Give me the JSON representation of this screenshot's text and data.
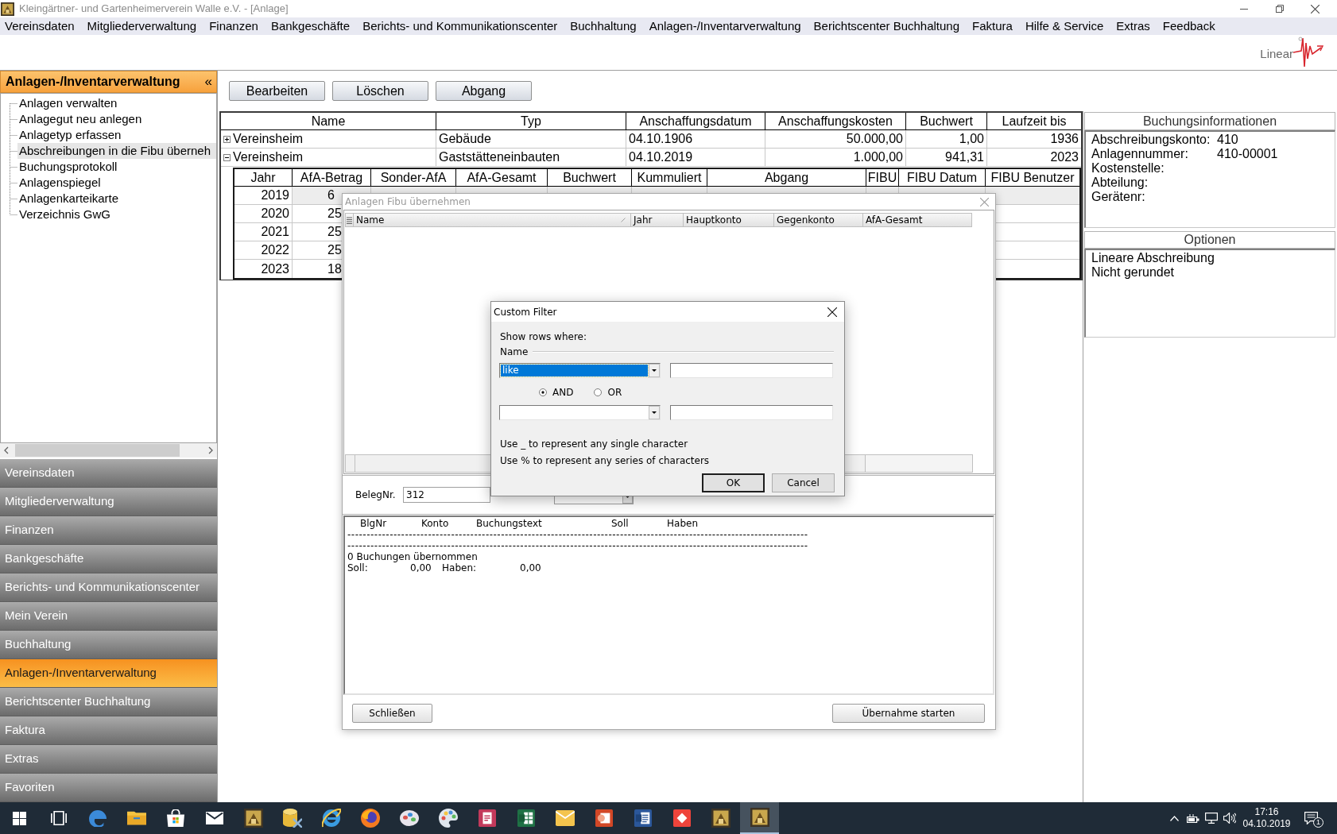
{
  "window": {
    "title": "Kleingärtner- und Gartenheimerverein Walle e.V. - [Anlage]"
  },
  "menu": [
    "Vereinsdaten",
    "Mitgliederverwaltung",
    "Finanzen",
    "Bankgeschäfte",
    "Berichts- und Kommunikationscenter",
    "Buchhaltung",
    "Anlagen-/Inventarverwaltung",
    "Berichtscenter Buchhaltung",
    "Faktura",
    "Hilfe & Service",
    "Extras",
    "Feedback"
  ],
  "logo": {
    "text": "Linear"
  },
  "sidebar": {
    "title": "Anlagen-/Inventarverwaltung",
    "collapse": "«",
    "tree": [
      {
        "label": "Anlagen verwalten",
        "selected": false
      },
      {
        "label": "Anlagegut neu anlegen",
        "selected": false
      },
      {
        "label": "Anlagetyp erfassen",
        "selected": false
      },
      {
        "label": "Abschreibungen in die Fibu überneh",
        "selected": true
      },
      {
        "label": "Buchungsprotokoll",
        "selected": false
      },
      {
        "label": "Anlagenspiegel",
        "selected": false
      },
      {
        "label": "Anlagenkarteikarte",
        "selected": false
      },
      {
        "label": "Verzeichnis GwG",
        "selected": false
      }
    ],
    "nav": [
      {
        "label": "Vereinsdaten",
        "selected": false
      },
      {
        "label": "Mitgliederverwaltung",
        "selected": false
      },
      {
        "label": "Finanzen",
        "selected": false
      },
      {
        "label": "Bankgeschäfte",
        "selected": false
      },
      {
        "label": "Berichts- und Kommunikationscenter",
        "selected": false
      },
      {
        "label": "Mein Verein",
        "selected": false
      },
      {
        "label": "Buchhaltung",
        "selected": false
      },
      {
        "label": "Anlagen-/Inventarverwaltung",
        "selected": true
      },
      {
        "label": "Berichtscenter Buchhaltung",
        "selected": false
      },
      {
        "label": "Faktura",
        "selected": false
      },
      {
        "label": "Extras",
        "selected": false
      },
      {
        "label": "Favoriten",
        "selected": false
      }
    ]
  },
  "toolbar": [
    "Bearbeiten",
    "Löschen",
    "Abgang"
  ],
  "table": {
    "columns": [
      "Name",
      "Typ",
      "Anschaffungsdatum",
      "Anschaffungskosten",
      "Buchwert",
      "Laufzeit bis"
    ],
    "rows": [
      {
        "expanded": false,
        "cells": [
          "Vereinsheim",
          "Gebäude",
          "04.10.1906",
          "50.000,00",
          "1,00",
          "1936"
        ]
      },
      {
        "expanded": true,
        "cells": [
          "Vereinsheim",
          "Gaststätteneinbauten",
          "04.10.2019",
          "1.000,00",
          "941,31",
          "2023"
        ],
        "detail": {
          "columns": [
            "Jahr",
            "AfA-Betrag",
            "Sonder-AfA",
            "AfA-Gesamt",
            "Buchwert",
            "Kummuliert",
            "Abgang",
            "FIBU",
            "FIBU Datum",
            "FIBU Benutzer"
          ],
          "rows": [
            {
              "selected": true,
              "cells": [
                "2019",
                "6"
              ]
            },
            {
              "selected": false,
              "cells": [
                "2020",
                "25"
              ]
            },
            {
              "selected": false,
              "cells": [
                "2021",
                "25"
              ]
            },
            {
              "selected": false,
              "cells": [
                "2022",
                "25"
              ]
            },
            {
              "selected": false,
              "cells": [
                "2023",
                "18"
              ]
            }
          ]
        }
      }
    ]
  },
  "booking_info": {
    "title": "Buchungsinformationen",
    "fields": [
      {
        "label": "Abschreibungskonto:",
        "value": "410"
      },
      {
        "label": "Anlagennummer:",
        "value": "410-00001"
      },
      {
        "label": "Kostenstelle:"
      },
      {
        "label": "Abteilung:"
      },
      {
        "label": "Gerätenr:"
      }
    ]
  },
  "options": {
    "title": "Optionen",
    "lines": [
      "Lineare Abschreibung",
      "Nicht gerundet"
    ]
  },
  "fibu_dialog": {
    "title": "Anlagen Fibu übernehmen",
    "grid_columns": [
      "Name",
      "Jahr",
      "Hauptkonto",
      "Gegenkonto",
      "AfA-Gesamt"
    ],
    "beleg_label": "BelegNr.",
    "beleg_value": "312",
    "log": {
      "columns": [
        "BlgNr",
        "Konto",
        "Buchungstext",
        "Soll",
        "Haben"
      ],
      "rules": [
        "------------------------------------------------------------------------------------------------------------------------",
        "------------------------------------------------------------------------------------------------------------------------"
      ],
      "summary": "0 Buchungen übernommen",
      "totals": [
        {
          "label": "Soll:",
          "value": "0,00"
        },
        {
          "label": "Haben:",
          "value": "0,00"
        }
      ]
    },
    "buttons": [
      "Schließen",
      "Übernahme starten"
    ]
  },
  "filter_dialog": {
    "title": "Custom Filter",
    "prompt": "Show rows where:",
    "field": "Name",
    "operator": "like",
    "operator_focused": true,
    "logic": [
      {
        "label": "AND",
        "selected": true
      },
      {
        "label": "OR",
        "selected": false
      }
    ],
    "hints": [
      "Use _ to represent any single character",
      "Use % to represent any series of characters"
    ],
    "buttons": [
      {
        "label": "OK",
        "default": true
      },
      {
        "label": "Cancel",
        "default": false
      }
    ]
  },
  "taskbar": {
    "apps": [
      {
        "kind": "start",
        "selected": false
      },
      {
        "kind": "taskview",
        "selected": false
      },
      {
        "kind": "edge",
        "selected": false
      },
      {
        "kind": "folder",
        "selected": false
      },
      {
        "kind": "store",
        "selected": false
      },
      {
        "kind": "mail",
        "selected": false
      },
      {
        "kind": "gold",
        "selected": false
      },
      {
        "kind": "database",
        "selected": false
      },
      {
        "kind": "ie",
        "selected": false
      },
      {
        "kind": "firefox",
        "selected": false
      },
      {
        "kind": "cloud",
        "selected": false
      },
      {
        "kind": "palette",
        "selected": false
      },
      {
        "kind": "redtile",
        "selected": false
      },
      {
        "kind": "excel",
        "selected": false
      },
      {
        "kind": "outlook",
        "selected": false
      },
      {
        "kind": "orangetile",
        "selected": false
      },
      {
        "kind": "word",
        "selected": false
      },
      {
        "kind": "diamond",
        "selected": false
      },
      {
        "kind": "gold",
        "selected": false
      },
      {
        "kind": "gold",
        "selected": true
      }
    ],
    "time": "17:16",
    "date": "04.10.2019",
    "notifications": "1"
  }
}
